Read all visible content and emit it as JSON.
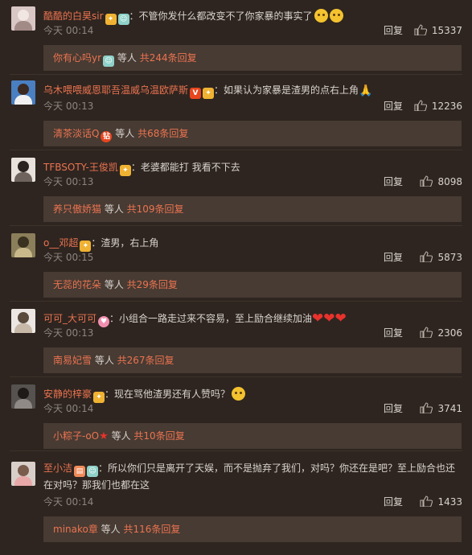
{
  "comments": [
    {
      "user": "酷酷的白昊sir",
      "text": "：不管你发什么都改变不了你家暴的事实了",
      "time": "今天 00:14",
      "reply": "回复",
      "likes": "15337",
      "thread": {
        "name": "你有心吗yr",
        "mid": " 等人 ",
        "more": "共244条回复"
      },
      "avatar_color": "#d9c7c5"
    },
    {
      "user": "乌木喂喂威恩耶吾温威乌温欧萨斯",
      "text": "：如果认为家暴是渣男的点右上角",
      "time": "今天 00:13",
      "reply": "回复",
      "likes": "12236",
      "thread": {
        "name": "清茶淡话Q",
        "mid": " 等人 ",
        "more": "共68条回复"
      },
      "avatar_color": "#4a7fc1"
    },
    {
      "user": "TFBSOTY-王俊凯",
      "text": "：老婆都能打   我看不下去",
      "time": "今天 00:13",
      "reply": "回复",
      "likes": "8098",
      "thread": {
        "name": "养只傲娇猫",
        "mid": " 等人 ",
        "more": "共109条回复"
      },
      "avatar_color": "#e9e2dc"
    },
    {
      "user": "o__邓超",
      "text": "：渣男，右上角",
      "time": "今天 00:15",
      "reply": "回复",
      "likes": "5873",
      "thread": {
        "name": "无蕊的花朵",
        "mid": " 等人 ",
        "more": "共29条回复"
      },
      "avatar_color": "#8a7f5a"
    },
    {
      "user": "可可_大可可",
      "text": "：小组合一路走过来不容易，至上励合继续加油",
      "time": "今天 00:13",
      "reply": "回复",
      "likes": "2306",
      "thread": {
        "name": "南易妃雪",
        "mid": " 等人 ",
        "more": "共267条回复"
      },
      "avatar_color": "#ece7e2"
    },
    {
      "user": "安静的梓豪",
      "text": "：现在骂他渣男还有人赞吗？",
      "time": "今天 00:14",
      "reply": "回复",
      "likes": "3741",
      "thread": {
        "name": "小粽子-oO",
        "mid": " 等人 ",
        "more": "共10条回复"
      },
      "avatar_color": "#55524f"
    },
    {
      "user": "至小洁",
      "text": "：所以你们只是离开了天娱，而不是抛弃了我们，对吗？你还在是吧？至上励合也还在对吗？那我们也都在这",
      "time": "今天 00:14",
      "reply": "回复",
      "likes": "1433",
      "thread": {
        "name": "minako章",
        "mid": " 等人 ",
        "more": "共116条回复"
      },
      "avatar_color": "#d9cfc9"
    }
  ],
  "colors": {
    "background": "#2e2520",
    "username": "#eb7350",
    "thread_bg": "#473b33"
  }
}
